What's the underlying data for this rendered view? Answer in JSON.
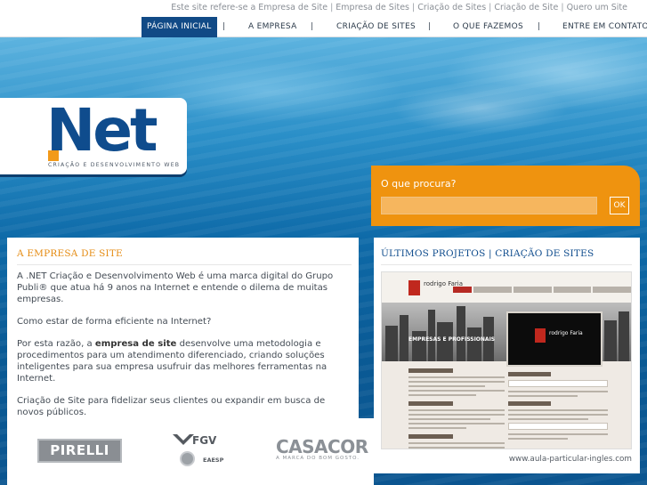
{
  "top_links": {
    "intro": "Este site refere-se a Empresa de Site",
    "links": [
      "Empresa de Sites",
      "Criação de Sites",
      "Criação de Site",
      "Quero um Site"
    ]
  },
  "nav": {
    "items": [
      "PÁGINA INICIAL",
      "A EMPRESA",
      "CRIAÇÃO DE SITES",
      "O QUE FAZEMOS",
      "ENTRE EM CONTATO"
    ],
    "separator": "|",
    "active_color": "#114a86"
  },
  "logo": {
    "name": "Net",
    "dot_color": "#f29a1a",
    "brand_color": "#0f4c8d",
    "tagline": "CRIAÇÃO E DESENVOLVIMENTO WEB"
  },
  "search": {
    "label": "O que procura?",
    "value": "",
    "button": "OK",
    "accent": "#ef930f"
  },
  "about": {
    "title": "A EMPRESA DE SITE",
    "p1": "A .NET Criação e Desenvolvimento Web é uma marca digital do Grupo Publi® que atua há 9 anos na Internet e entende o dilema de muitas empresas.",
    "p2": "Como estar de forma eficiente na Internet?",
    "p3_pre": "Por esta razão, a ",
    "p3_bold": "empresa de site",
    "p3_post": " desenvolve uma metodologia e procedimentos para um atendimento diferenciado, criando soluções inteligentes para sua empresa usufruir das melhores ferramentas na Internet.",
    "p4": "Criação de Site para fidelizar seus clientes ou expandir em busca de novos públicos."
  },
  "clients": {
    "pirelli": "PIRELLI",
    "fgv": "FGV",
    "fgv_sub": "EAESP",
    "casacor": "CASACOR",
    "casacor_sub": "A MARCA DO BOM GOSTO."
  },
  "projects": {
    "title": "ÚLTIMOS PROJETOS | CRIAÇÃO DE SITES",
    "thumb_logo": "rodrigo Faria",
    "thumb_headline_1": "EMPRESAS E PROFISSIONAIS",
    "url": "www.aula-particular-ingles.com"
  }
}
